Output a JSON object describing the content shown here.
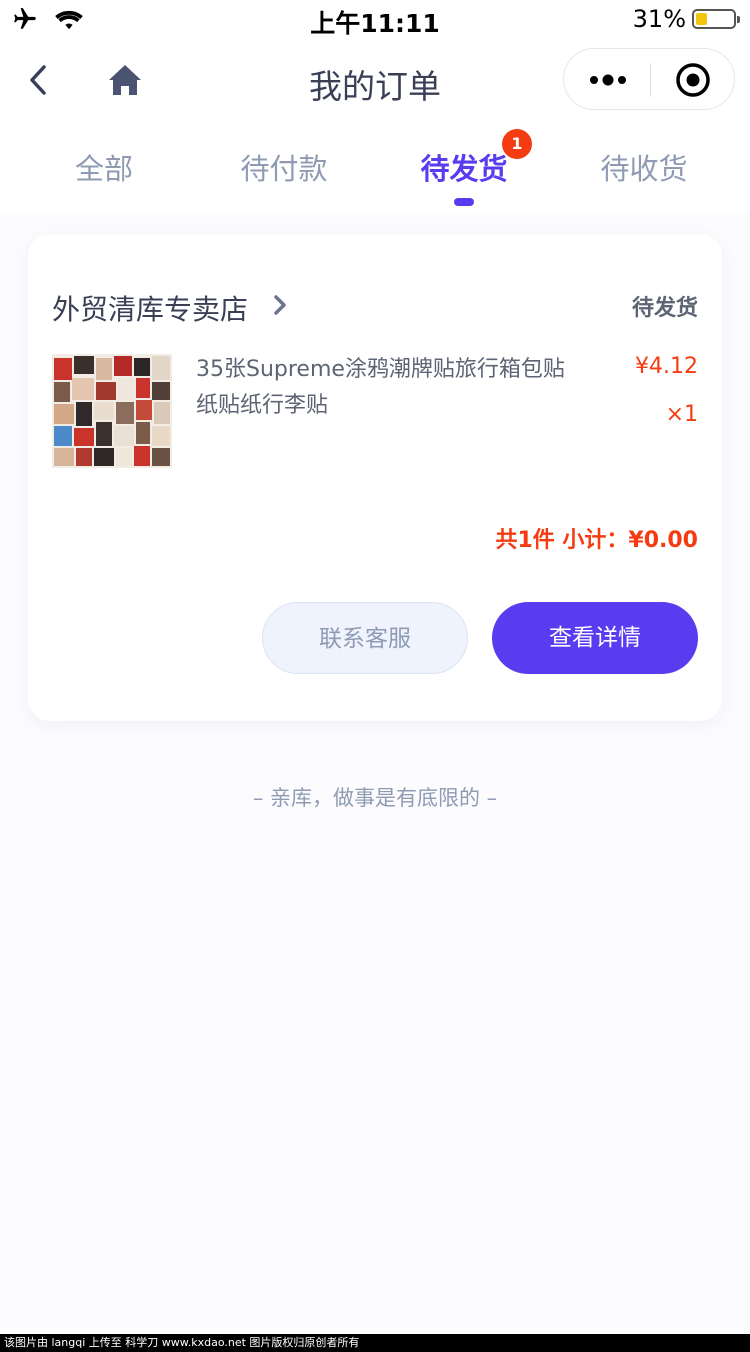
{
  "status_bar": {
    "time": "上午11:11",
    "battery_percent": "31%",
    "battery_level": 0.31
  },
  "nav": {
    "title": "我的订单"
  },
  "tabs": [
    {
      "label": "全部"
    },
    {
      "label": "待付款"
    },
    {
      "label": "待发货",
      "badge": "1",
      "active": true
    },
    {
      "label": "待收货"
    }
  ],
  "order": {
    "shop_name": "外贸清库专卖店",
    "status": "待发货",
    "product": {
      "title": "35张Supreme涂鸦潮牌贴旅行箱包贴纸贴纸行李贴",
      "price": "¥4.12",
      "quantity": "×1"
    },
    "subtotal": "共1件  小计：¥0.00",
    "buttons": {
      "contact": "联系客服",
      "detail": "查看详情"
    }
  },
  "footer_note": "– 亲库，做事是有底限的 –",
  "watermark": "该图片由 langqi 上传至 科学刀 www.kxdao.net 图片版权归原创者所有",
  "colors": {
    "accent": "#5a3cf0",
    "price": "#f53b12",
    "muted": "#8e9bb3"
  },
  "icons": [
    "airplane-icon",
    "wifi-icon",
    "battery-icon",
    "back-icon",
    "home-icon",
    "more-icon",
    "target-icon",
    "chevron-right-icon"
  ]
}
